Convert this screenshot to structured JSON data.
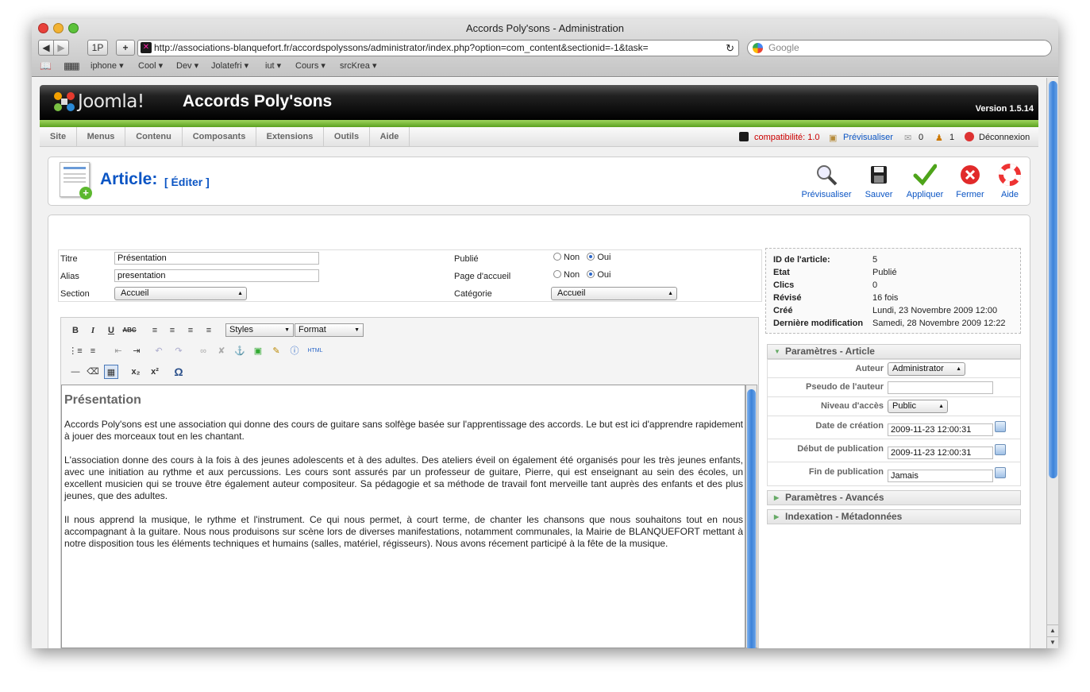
{
  "window": {
    "title": "Accords Poly'sons - Administration"
  },
  "browser": {
    "url": "http://associations-blanquefort.fr/accordspolyssons/administrator/index.php?option=com_content&sectionid=-1&task=",
    "search_placeholder": "Google",
    "back": "◀",
    "forward": "▶",
    "onep": "1P",
    "add": "+",
    "reload": "↻",
    "bookmarks": [
      "iphone ▾",
      "Cool ▾",
      "Dev ▾",
      "Jolatefri ▾",
      "iut ▾",
      "Cours ▾",
      "srcKrea ▾"
    ]
  },
  "header": {
    "brand": "Joomla!",
    "site_name": "Accords Poly'sons",
    "version": "Version 1.5.14"
  },
  "menu": {
    "items": [
      "Site",
      "Menus",
      "Contenu",
      "Composants",
      "Extensions",
      "Outils",
      "Aide"
    ]
  },
  "status": {
    "compat": "compatibilité: 1.0",
    "preview": "Prévisualiser",
    "messages": "0",
    "users": "1",
    "logout": "Déconnexion"
  },
  "page": {
    "title": "Article:",
    "subtitle": "[ Éditer ]"
  },
  "toolbar": {
    "preview": "Prévisualiser",
    "save": "Sauver",
    "apply": "Appliquer",
    "close": "Fermer",
    "help": "Aide"
  },
  "form": {
    "title_label": "Titre",
    "title_value": "Présentation",
    "alias_label": "Alias",
    "alias_value": "presentation",
    "section_label": "Section",
    "section_value": "Accueil",
    "published_label": "Publié",
    "frontpage_label": "Page d'accueil",
    "non": "Non",
    "oui": "Oui",
    "category_label": "Catégorie",
    "category_value": "Accueil"
  },
  "editor": {
    "styles": "Styles",
    "format": "Format",
    "html": "HTML",
    "heading": "Présentation",
    "paragraphs": [
      "Accords Poly'sons est une association qui donne des cours de guitare sans solfège basée sur l'apprentissage des accords. Le but est ici d'apprendre rapidement à jouer des morceaux tout en les chantant.",
      "L'association donne des cours à la fois à des jeunes adolescents et à des adultes. Des ateliers éveil on également été organisés pour les très jeunes enfants, avec une initiation au rythme et aux percussions. Les cours sont assurés par un professeur de guitare, Pierre, qui est enseignant au sein des écoles, un excellent musicien qui se trouve être également auteur compositeur. Sa pédagogie et sa méthode de travail font merveille tant auprès des enfants et des plus jeunes, que des adultes.",
      "Il nous apprend la musique, le rythme et l'instrument. Ce qui nous permet, à court terme, de chanter les chansons que nous souhaitons tout en nous accompagnant à la guitare. Nous nous produisons sur scène lors de diverses manifestations, notamment communales, la Mairie de BLANQUEFORT mettant à notre disposition tous les éléments techniques et humains (salles, matériel, régisseurs). Nous avons récement participé à la fête de la musique."
    ]
  },
  "info": [
    {
      "k": "ID de l'article:",
      "v": "5"
    },
    {
      "k": "Etat",
      "v": "Publié"
    },
    {
      "k": "Clics",
      "v": "0"
    },
    {
      "k": "Révisé",
      "v": "16 fois"
    },
    {
      "k": "Créé",
      "v": "Lundi, 23 Novembre 2009 12:00"
    },
    {
      "k": "Dernière modification",
      "v": "Samedi, 28 Novembre 2009 12:22"
    }
  ],
  "params": {
    "article_title": "Paramètres - Article",
    "author_label": "Auteur",
    "author_value": "Administrator",
    "alias_label": "Pseudo de l'auteur",
    "alias_value": "",
    "access_label": "Niveau d'accès",
    "access_value": "Public",
    "created_label": "Date de création",
    "created_value": "2009-11-23 12:00:31",
    "start_label": "Début de publication",
    "start_value": "2009-11-23 12:00:31",
    "end_label": "Fin de publication",
    "end_value": "Jamais",
    "advanced_title": "Paramètres - Avancés",
    "meta_title": "Indexation - Métadonnées"
  }
}
